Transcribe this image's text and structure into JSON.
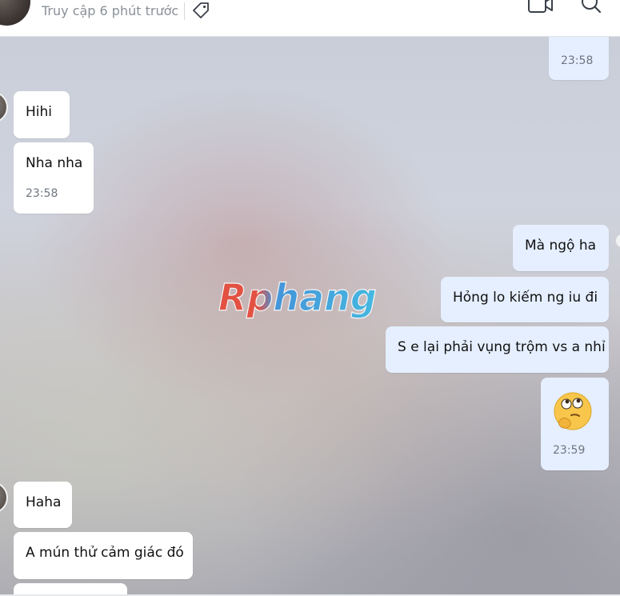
{
  "header": {
    "status_text": "Truy cập 6 phút trước",
    "icons": [
      "tag-icon",
      "video-call-icon",
      "search-icon"
    ]
  },
  "watermark": {
    "text": "Rphang"
  },
  "messages": [
    {
      "side": "out",
      "text": "",
      "time": "23:58"
    },
    {
      "side": "in",
      "text": "Hihi"
    },
    {
      "side": "in",
      "text": "Nha nha",
      "time": "23:58"
    },
    {
      "side": "out",
      "text": "Mà ngộ ha"
    },
    {
      "side": "out",
      "text": "Hỏng lo kiếm ng iu đi"
    },
    {
      "side": "out",
      "text": "S e lại phải vụng trộm vs a nhỉ"
    },
    {
      "side": "out",
      "emoji": "thinking-face",
      "time": "23:59"
    },
    {
      "side": "in",
      "text": "Haha"
    },
    {
      "side": "in",
      "text": "A mún thử cảm giác đó"
    },
    {
      "side": "in",
      "text": ""
    }
  ],
  "colors": {
    "incoming_bubble": "#ffffff",
    "outgoing_bubble": "#e5efff",
    "time_text": "#6f7680",
    "header_status": "#8a8f98"
  }
}
